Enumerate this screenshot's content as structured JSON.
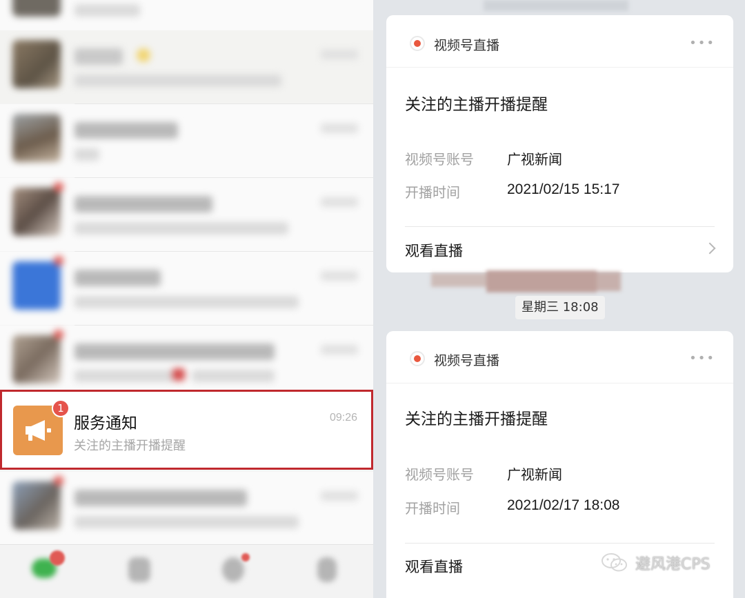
{
  "chat_list": {
    "service_item": {
      "title": "服务通知",
      "preview": "关注的主播开播提醒",
      "time": "09:26",
      "unread_count": "1"
    }
  },
  "cards": [
    {
      "header": "视频号直播",
      "more": "•••",
      "title": "关注的主播开播提醒",
      "account_label": "视频号账号",
      "account_value": "广视新闻",
      "time_label": "开播时间",
      "time_value": "2021/02/15 15:17",
      "action": "观看直播"
    },
    {
      "header": "视频号直播",
      "more": "•••",
      "title": "关注的主播开播提醒",
      "account_label": "视频号账号",
      "account_value": "广视新闻",
      "time_label": "开播时间",
      "time_value": "2021/02/17 18:08",
      "action": "观看直播"
    }
  ],
  "divider_time": "星期三 18:08",
  "watermark": "避风港CPS",
  "colors": {
    "highlight_border": "#c0292e",
    "service_avatar": "#e8984d",
    "badge": "#e5534b",
    "live_dot": "#e9583f"
  },
  "icons": {
    "service_avatar": "megaphone-icon",
    "live": "live-dot-icon",
    "more": "more-dots-icon",
    "chevron": "chevron-right-icon",
    "watermark": "wechat-icon"
  }
}
